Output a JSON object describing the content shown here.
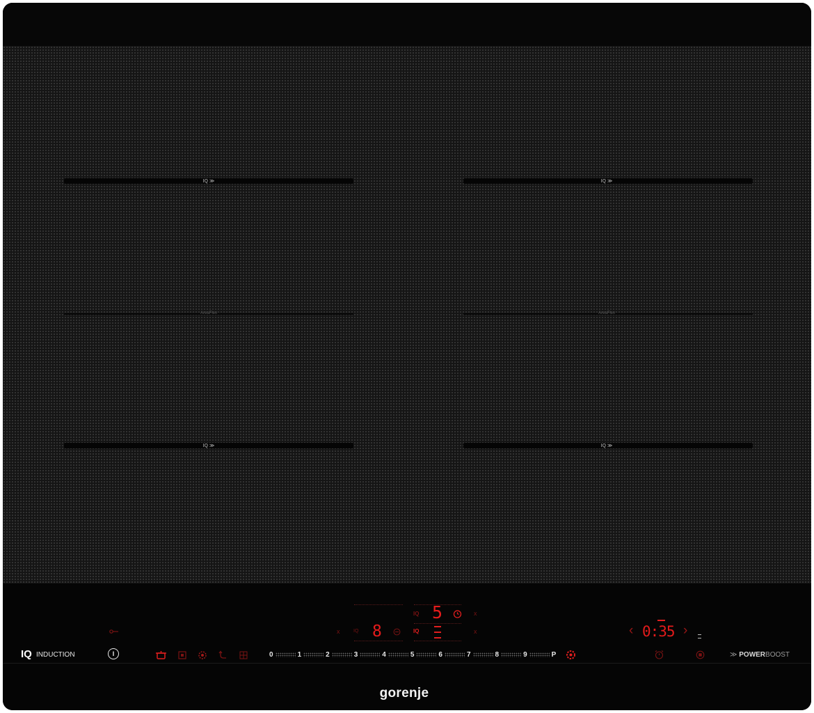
{
  "zones": {
    "labels": [
      "IQ ≫",
      "IQ ≫",
      "AreaFlex",
      "AreaFlex",
      "IQ ≫",
      "IQ ≫"
    ]
  },
  "display": {
    "top_level": "5",
    "bottom_level": "8",
    "iq_top": "IQ",
    "iq_bottom": "IQ",
    "iq_small": "IQ",
    "timer": "0:35",
    "timer_prev": "‹",
    "timer_next": "›",
    "close_marks": [
      "x",
      "x",
      "x",
      "x"
    ]
  },
  "controls": {
    "iq_logo": "IQ",
    "induction_label": "INDUCTION",
    "power_symbol": "I",
    "power_scale": [
      "0",
      "1",
      "2",
      "3",
      "4",
      "5",
      "6",
      "7",
      "8",
      "9",
      "P"
    ],
    "powerboost_prefix": "≫",
    "powerboost_bold": "POWER",
    "powerboost_rest": "BOOST"
  },
  "brand": "gorenje",
  "colors": {
    "accent_red": "#e01e1e",
    "glass": "#151515",
    "panel": "#050505"
  },
  "icons": [
    "power-icon",
    "pot-icon",
    "square-icon",
    "gear-fan-icon",
    "return-arrow-icon",
    "grid-icon",
    "clock-icon",
    "lock-gear-icon",
    "alarm-icon",
    "stop-icon",
    "key-icon"
  ]
}
